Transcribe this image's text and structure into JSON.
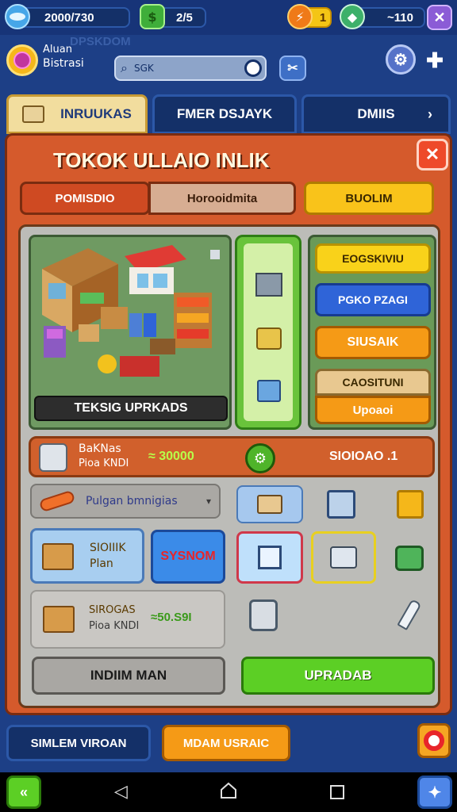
{
  "topbar": {
    "coins": "2000/730",
    "cash": "2/5",
    "energy": "1",
    "gems": "~110"
  },
  "profile": {
    "name": "Aluan",
    "subtitle": "Bistrasi",
    "bg_text": "DPSKDOM"
  },
  "search": {
    "placeholder": "SGK"
  },
  "tabs": [
    {
      "label": "INRUUKAS"
    },
    {
      "label": "FMER DSJAYK"
    },
    {
      "label": "DMIIS"
    }
  ],
  "panel": {
    "title": "TOKOK ULLAIO INLIK",
    "subtabs": [
      "POMISDIO",
      "Horooidmita",
      "BUOLIM"
    ],
    "preview_caption": "TEKSIG UPRKADS",
    "side_buttons": [
      "EOGSKIVIU",
      "PGKO PZAGI",
      "SIUSAIK",
      "CAOSITUNI",
      "Upoaoi"
    ],
    "info": {
      "line1": "BaKNas",
      "line2": "Pioa KNDI",
      "amount": "≈ 30000",
      "status": "SIOIOAO .1"
    },
    "dropdown": "Pulgan bmnigias",
    "item1": {
      "line1": "SIOIIIK",
      "line2": "Plan"
    },
    "system_button": "SYSNOM",
    "item2": {
      "line1": "SIROGAS",
      "line2": "Pioa KNDI",
      "amount": "≈50.S9I"
    },
    "bottom_left_button": "INDIIM MAN",
    "upgrade_button": "UPRADAB"
  },
  "footer": {
    "left_button": "SIMLEM VIROAN",
    "right_button": "MDAM USRAIC"
  },
  "colors": {
    "background": "#1d3f86",
    "panel": "#d55a2c",
    "upgrade_green": "#5ccf25",
    "yellow_button": "#f9c31a",
    "blue_button": "#2f64d8",
    "orange_button": "#f59a16"
  }
}
